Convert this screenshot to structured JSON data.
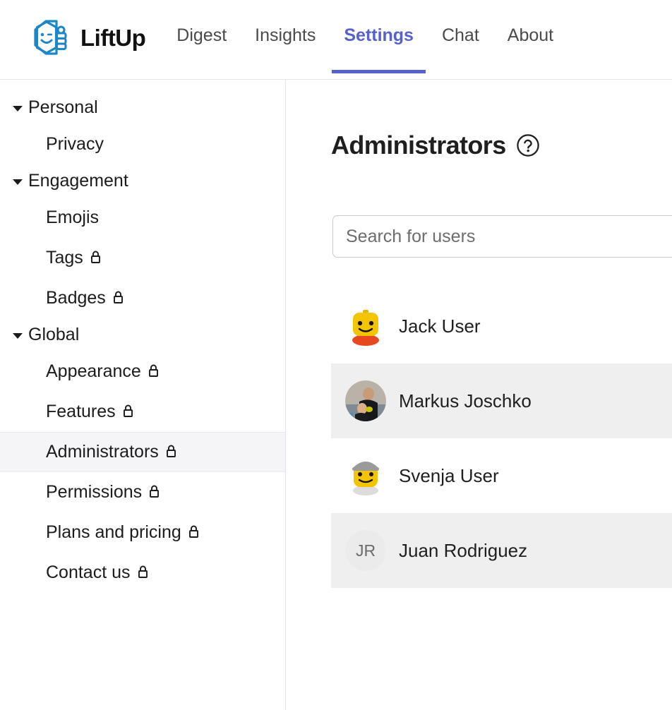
{
  "header": {
    "brand_name": "LiftUp",
    "logo_icon": "liftup-thumbsup-logo",
    "accent_color": "#5661cc",
    "nav": [
      {
        "label": "Digest",
        "active": false
      },
      {
        "label": "Insights",
        "active": false
      },
      {
        "label": "Settings",
        "active": true
      },
      {
        "label": "Chat",
        "active": false
      },
      {
        "label": "About",
        "active": false
      }
    ]
  },
  "sidebar": {
    "groups": [
      {
        "label": "Personal",
        "expanded": true,
        "items": [
          {
            "label": "Privacy",
            "locked": false,
            "selected": false
          }
        ]
      },
      {
        "label": "Engagement",
        "expanded": true,
        "items": [
          {
            "label": "Emojis",
            "locked": false,
            "selected": false
          },
          {
            "label": "Tags",
            "locked": true,
            "selected": false
          },
          {
            "label": "Badges",
            "locked": true,
            "selected": false
          }
        ]
      },
      {
        "label": "Global",
        "expanded": true,
        "items": [
          {
            "label": "Appearance",
            "locked": true,
            "selected": false
          },
          {
            "label": "Features",
            "locked": true,
            "selected": false
          },
          {
            "label": "Administrators",
            "locked": true,
            "selected": true
          },
          {
            "label": "Permissions",
            "locked": true,
            "selected": false
          },
          {
            "label": "Plans and pricing",
            "locked": true,
            "selected": false
          },
          {
            "label": "Contact us",
            "locked": true,
            "selected": false
          }
        ]
      }
    ]
  },
  "main": {
    "title": "Administrators",
    "help_icon": "question-circle-icon",
    "search": {
      "placeholder": "Search for users",
      "value": ""
    },
    "users": [
      {
        "name": "Jack User",
        "avatar_type": "lego-yellow",
        "initials": "",
        "highlighted": false
      },
      {
        "name": "Markus Joschko",
        "avatar_type": "photo",
        "initials": "",
        "highlighted": true
      },
      {
        "name": "Svenja User",
        "avatar_type": "lego-gray-hair",
        "initials": "",
        "highlighted": false
      },
      {
        "name": "Juan Rodriguez",
        "avatar_type": "initials",
        "initials": "JR",
        "highlighted": true
      }
    ]
  }
}
